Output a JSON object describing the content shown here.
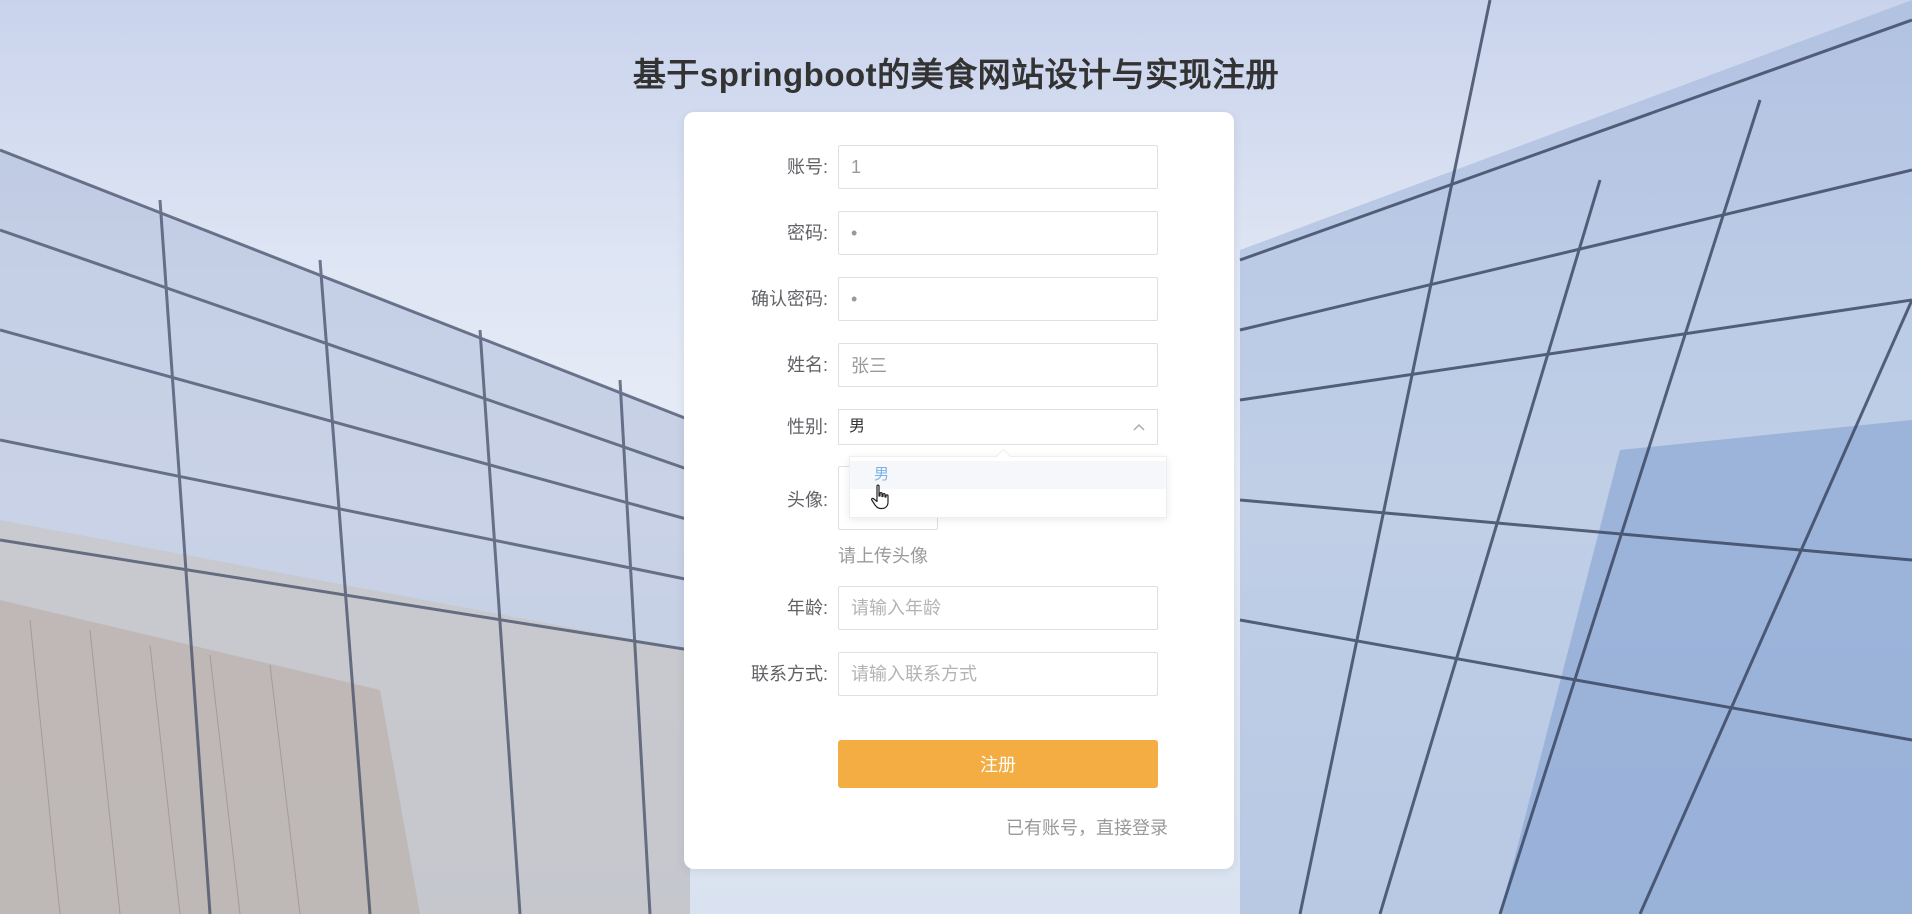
{
  "page": {
    "title": "基于springboot的美食网站设计与实现注册"
  },
  "form": {
    "account": {
      "label": "账号:",
      "value": "1"
    },
    "password": {
      "label": "密码:",
      "value": "•"
    },
    "confirm_password": {
      "label": "确认密码:",
      "value": "•"
    },
    "name": {
      "label": "姓名:",
      "value": "张三"
    },
    "gender": {
      "label": "性别:",
      "value": "男",
      "options": [
        "男"
      ],
      "open": true
    },
    "avatar": {
      "label": "头像:",
      "hint": "请上传头像"
    },
    "age": {
      "label": "年龄:",
      "placeholder": "请输入年龄"
    },
    "contact": {
      "label": "联系方式:",
      "placeholder": "请输入联系方式"
    },
    "submit_label": "注册",
    "login_link": "已有账号，直接登录"
  },
  "colors": {
    "primary_button": "#f4ad43",
    "option_highlight": "#7db0e6",
    "card_bg": "#ffffff"
  },
  "icons": {
    "select_arrow": "chevron-up-icon",
    "cursor": "hand-pointer-icon"
  }
}
